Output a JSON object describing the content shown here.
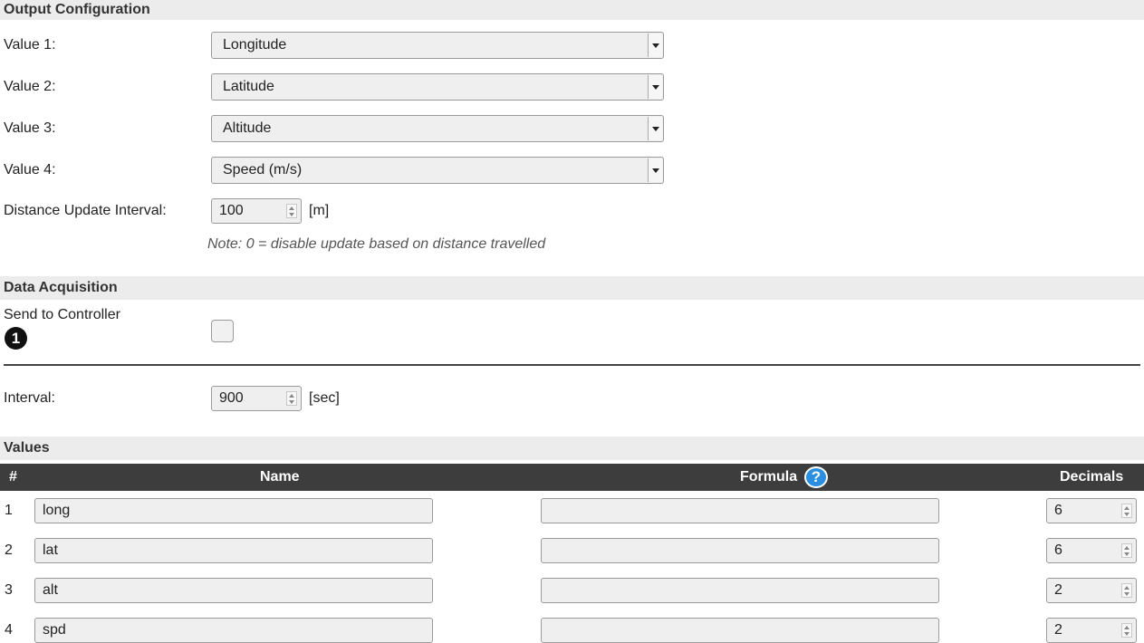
{
  "output_config": {
    "title": "Output Configuration",
    "values": [
      {
        "label": "Value 1:",
        "selected": "Longitude"
      },
      {
        "label": "Value 2:",
        "selected": "Latitude"
      },
      {
        "label": "Value 3:",
        "selected": "Altitude"
      },
      {
        "label": "Value 4:",
        "selected": "Speed (m/s)"
      }
    ],
    "distance_label": "Distance Update Interval:",
    "distance_value": "100",
    "distance_unit": "[m]",
    "note": "Note: 0 = disable update based on distance travelled"
  },
  "data_acquisition": {
    "title": "Data Acquisition",
    "send_label": "Send to Controller",
    "send_badge": "1",
    "send_checked": false,
    "interval_label": "Interval:",
    "interval_value": "900",
    "interval_unit": "[sec]"
  },
  "values_table": {
    "title": "Values",
    "headers": {
      "num": "#",
      "name": "Name",
      "formula": "Formula",
      "decimals": "Decimals"
    },
    "help_glyph": "?",
    "rows": [
      {
        "num": "1",
        "name": "long",
        "formula": "",
        "decimals": "6"
      },
      {
        "num": "2",
        "name": "lat",
        "formula": "",
        "decimals": "6"
      },
      {
        "num": "3",
        "name": "alt",
        "formula": "",
        "decimals": "2"
      },
      {
        "num": "4",
        "name": "spd",
        "formula": "",
        "decimals": "2"
      }
    ]
  },
  "icons": {
    "select_arrow": "chevron-down-icon",
    "spinner": "spinner-arrows-icon",
    "info": "info-number-icon",
    "help": "question-circle-icon"
  }
}
